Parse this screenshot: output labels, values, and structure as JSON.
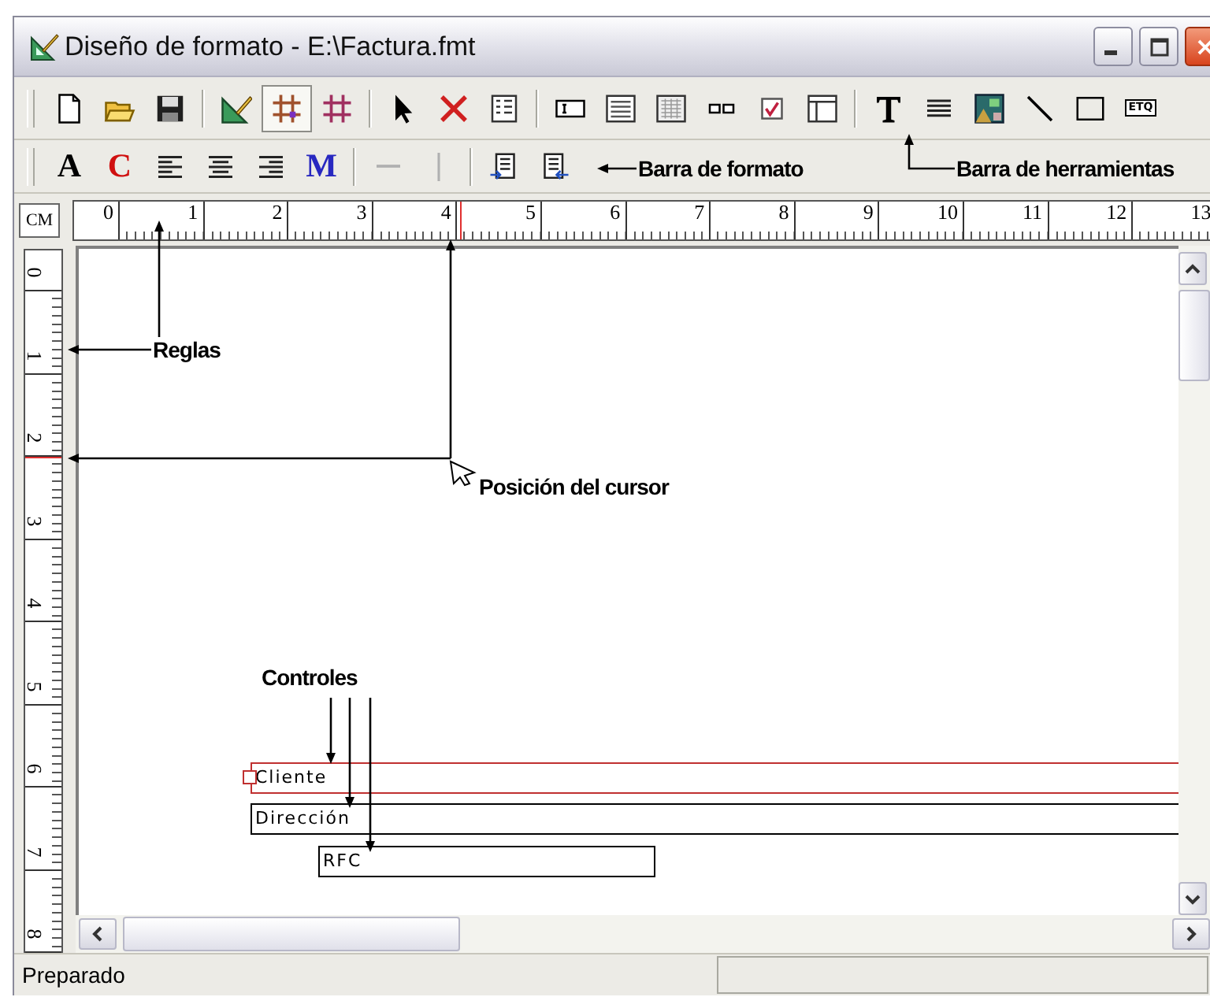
{
  "window": {
    "title": "Diseño de formato - E:\\Factura.fmt"
  },
  "toolbar": {
    "groups": [
      {
        "items": [
          {
            "kind": "new",
            "pressed": false
          },
          {
            "kind": "open",
            "pressed": false
          },
          {
            "kind": "save",
            "pressed": false
          }
        ]
      },
      {
        "items": [
          {
            "kind": "design",
            "pressed": false
          },
          {
            "kind": "snap-grid",
            "pressed": true
          },
          {
            "kind": "grid",
            "pressed": false
          }
        ]
      },
      {
        "items": [
          {
            "kind": "pointer",
            "pressed": false
          },
          {
            "kind": "delete",
            "pressed": false
          },
          {
            "kind": "form",
            "pressed": false
          }
        ]
      },
      {
        "items": [
          {
            "kind": "textbox",
            "pressed": false
          },
          {
            "kind": "listbox",
            "pressed": false
          },
          {
            "kind": "gridbox",
            "pressed": false
          },
          {
            "kind": "pair",
            "pressed": false
          },
          {
            "kind": "check",
            "pressed": false
          },
          {
            "kind": "table",
            "pressed": false
          }
        ]
      },
      {
        "items": [
          {
            "kind": "text",
            "pressed": false
          },
          {
            "kind": "lines",
            "pressed": false
          },
          {
            "kind": "picture",
            "pressed": false
          },
          {
            "kind": "line",
            "pressed": false
          },
          {
            "kind": "rectangle",
            "pressed": false
          },
          {
            "kind": "label",
            "text": "ETQ",
            "pressed": false
          }
        ]
      }
    ]
  },
  "format_bar": {
    "groups": [
      {
        "items": [
          {
            "kind": "glyph",
            "text": "A",
            "color": "#000000",
            "disabled": false
          },
          {
            "kind": "glyph",
            "text": "C",
            "color": "#d01010",
            "disabled": false
          },
          {
            "kind": "align-left",
            "disabled": false
          },
          {
            "kind": "align-center",
            "disabled": false
          },
          {
            "kind": "align-right",
            "disabled": false
          },
          {
            "kind": "glyph",
            "text": "M",
            "color": "#2828c0",
            "disabled": false
          }
        ]
      },
      {
        "items": [
          {
            "kind": "hline",
            "disabled": true
          },
          {
            "kind": "vline",
            "disabled": true
          }
        ]
      },
      {
        "items": [
          {
            "kind": "forward",
            "disabled": false
          },
          {
            "kind": "backward",
            "disabled": false
          }
        ]
      }
    ]
  },
  "ruler": {
    "unit": "CM",
    "horizontal": [
      "0",
      "1",
      "2",
      "3",
      "4",
      "5",
      "6",
      "7",
      "8",
      "9",
      "10",
      "11",
      "12",
      "13"
    ],
    "vertical": [
      "0",
      "1",
      "2",
      "3",
      "4",
      "5",
      "6",
      "7",
      "8"
    ]
  },
  "annotations": [
    {
      "text": "Barra de formato"
    },
    {
      "text": "Barra de herramientas"
    },
    {
      "text": "Reglas"
    },
    {
      "text": "Posición del cursor"
    },
    {
      "text": "Controles"
    }
  ],
  "controls": [
    {
      "text": "Cliente",
      "selected": true
    },
    {
      "text": "Dirección",
      "selected": false
    },
    {
      "text": "RFC",
      "selected": false
    }
  ],
  "status_bar": {
    "text": "Preparado"
  }
}
